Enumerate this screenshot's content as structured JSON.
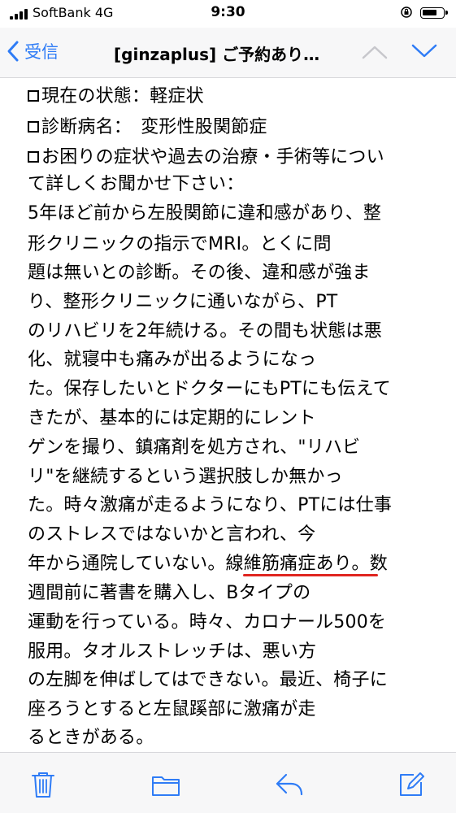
{
  "status_bar": {
    "carrier": "SoftBank  4G",
    "time": "9:30",
    "signal_icon": "signal-bars-icon",
    "lock_icon": "orientation-lock-icon",
    "battery_icon": "battery-icon"
  },
  "nav": {
    "back_label": "受信",
    "title": "[ginzaplus] ご予約あり…",
    "back_icon": "chevron-left-icon",
    "prev_icon": "chevron-up-icon",
    "next_icon": "chevron-down-icon",
    "accent_color": "#2f7cf6"
  },
  "body": {
    "lines": [
      "現在の状態：軽症状",
      "診断病名：　変形性股関節症",
      "お困りの症状や過去の治療・手術等につい",
      "て詳しくお聞かせ下さい：",
      "5年ほど前から左股関節に違和感があり、整",
      "形クリニックの指示でMRI。とくに問",
      "題は無いとの診断。その後、違和感が強ま",
      "り、整形クリニックに通いながら、PT",
      "のリハビリを2年続ける。その間も状態は悪",
      "化、就寝中も痛みが出るようになっ",
      "た。保存したいとドクターにもPTにも伝えて",
      "きたが、基本的には定期的にレント",
      "ゲンを撮り、鎮痛剤を処方され、\"リハビ",
      "リ\"を継続するという選択肢しか無かっ",
      "た。時々激痛が走るようになり、PTには仕事",
      "のストレスではないかと言われ、今",
      "年から通院していない。線維筋痛症あり。数",
      "週間前に著書を購入し、Bタイプの",
      "運動を行っている。時々、カロナール500を",
      "服用。タオルストレッチは、悪い方",
      "の左脚を伸ばしてはできない。最近、椅子に",
      "座ろうとすると左鼠蹊部に激痛が走",
      "るときがある。"
    ],
    "highlight_color": "#e02520"
  },
  "toolbar": {
    "trash_icon": "trash-icon",
    "folder_icon": "folder-icon",
    "reply_icon": "reply-icon",
    "compose_icon": "compose-icon"
  }
}
